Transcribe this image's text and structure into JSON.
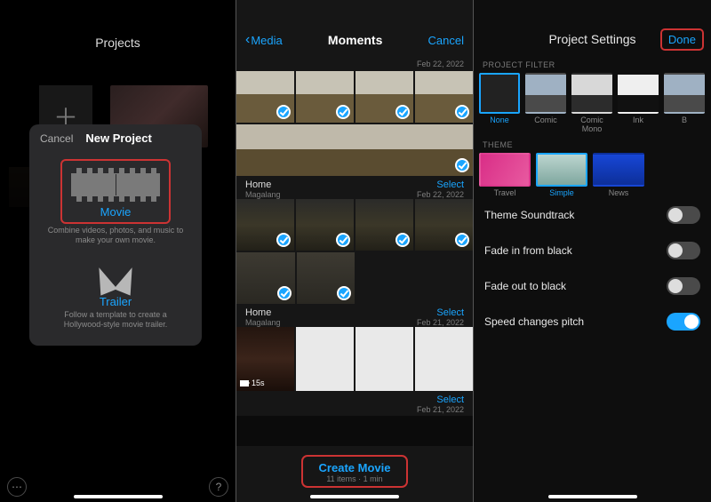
{
  "pane1": {
    "screen_title": "Projects",
    "modal": {
      "cancel": "Cancel",
      "title": "New Project",
      "movie": {
        "label": "Movie",
        "desc": "Combine videos, photos, and music to make your own movie."
      },
      "trailer": {
        "label": "Trailer",
        "desc": "Follow a template to create a Hollywood-style movie trailer."
      }
    },
    "ellipsis": "⋯",
    "question": "?"
  },
  "pane2": {
    "back": "Media",
    "title": "Moments",
    "cancel": "Cancel",
    "top_date": "Feb 22, 2022",
    "sections": [
      {
        "name": "Home",
        "sub": "Magalang",
        "action": "Select",
        "date": "Feb 22, 2022"
      },
      {
        "name": "Home",
        "sub": "Magalang",
        "action": "Select",
        "date": "Feb 21, 2022"
      },
      {
        "name": "",
        "sub": "",
        "action": "Select",
        "date": "Feb 21, 2022"
      }
    ],
    "clip_duration": "15s",
    "create": {
      "label": "Create Movie",
      "sub": "11 items · 1 min"
    }
  },
  "pane3": {
    "title": "Project Settings",
    "done": "Done",
    "filter_header": "PROJECT FILTER",
    "filters": [
      {
        "label": "None",
        "selected": true
      },
      {
        "label": "Comic"
      },
      {
        "label": "Comic Mono"
      },
      {
        "label": "Ink"
      },
      {
        "label": "B"
      }
    ],
    "theme_header": "THEME",
    "themes": [
      {
        "label": "Travel"
      },
      {
        "label": "Simple",
        "selected": true
      },
      {
        "label": "News"
      }
    ],
    "rows": [
      {
        "label": "Theme Soundtrack",
        "on": false
      },
      {
        "label": "Fade in from black",
        "on": false
      },
      {
        "label": "Fade out to black",
        "on": false
      },
      {
        "label": "Speed changes pitch",
        "on": true
      }
    ]
  }
}
